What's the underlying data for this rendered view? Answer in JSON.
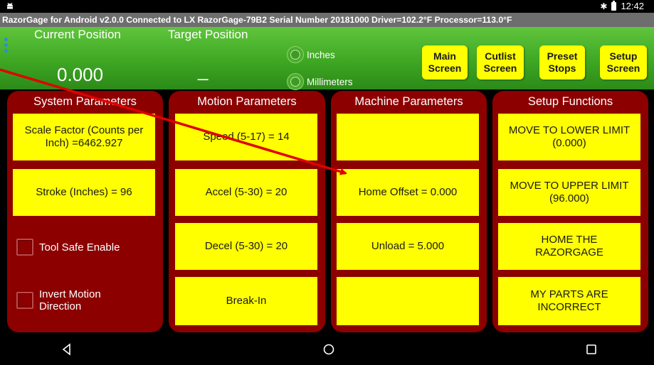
{
  "statusbar": {
    "time": "12:42",
    "icons": [
      "android-icon",
      "bluetooth-icon",
      "battery-icon"
    ]
  },
  "infobar": {
    "text": "RazorGage for Android v2.0.0  Connected to LX RazorGage-79B2  Serial Number 20181000   Driver=102.2°F  Processor=113.0°F"
  },
  "header": {
    "current_position_label": "Current Position",
    "current_position_value": "0.000",
    "target_position_label": "Target Position",
    "target_position_value": "_",
    "unit_options": [
      "Inches",
      "Millimeters"
    ],
    "nav_buttons": [
      {
        "line1": "Main",
        "line2": "Screen"
      },
      {
        "line1": "Cutlist",
        "line2": "Screen"
      },
      {
        "line1": "Preset",
        "line2": "Stops"
      },
      {
        "line1": "Setup",
        "line2": "Screen"
      }
    ],
    "active_nav": "Setup Screen"
  },
  "system": {
    "title": "System Parameters",
    "scale_factor": "Scale Factor (Counts per Inch) =6462.927",
    "stroke": "Stroke (Inches) = 96",
    "tool_safe": "Tool Safe Enable",
    "invert_line1": "Invert Motion",
    "invert_line2": "Direction"
  },
  "motion": {
    "title": "Motion Parameters",
    "speed": "Speed (5-17) = 14",
    "accel": "Accel (5-30) = 20",
    "decel": "Decel (5-30) = 20",
    "breakin": "Break-In"
  },
  "machine": {
    "title": "Machine Parameters",
    "blank1": "",
    "home_offset": "Home Offset = 0.000",
    "unload": "Unload = 5.000",
    "blank2": ""
  },
  "setup": {
    "title": "Setup Functions",
    "lower_line1": "MOVE TO LOWER LIMIT",
    "lower_line2": "(0.000)",
    "upper_line1": "MOVE TO UPPER LIMIT",
    "upper_line2": "(96.000)",
    "home_line1": "HOME THE",
    "home_line2": "RAZORGAGE",
    "parts_line1": "MY PARTS ARE",
    "parts_line2": "INCORRECT"
  },
  "colors": {
    "yellow": "#ffff00",
    "panel": "#8c0000",
    "header_green": "#3ea723",
    "info_gray": "#6e6e6e",
    "arrow_red": "#e00000"
  }
}
